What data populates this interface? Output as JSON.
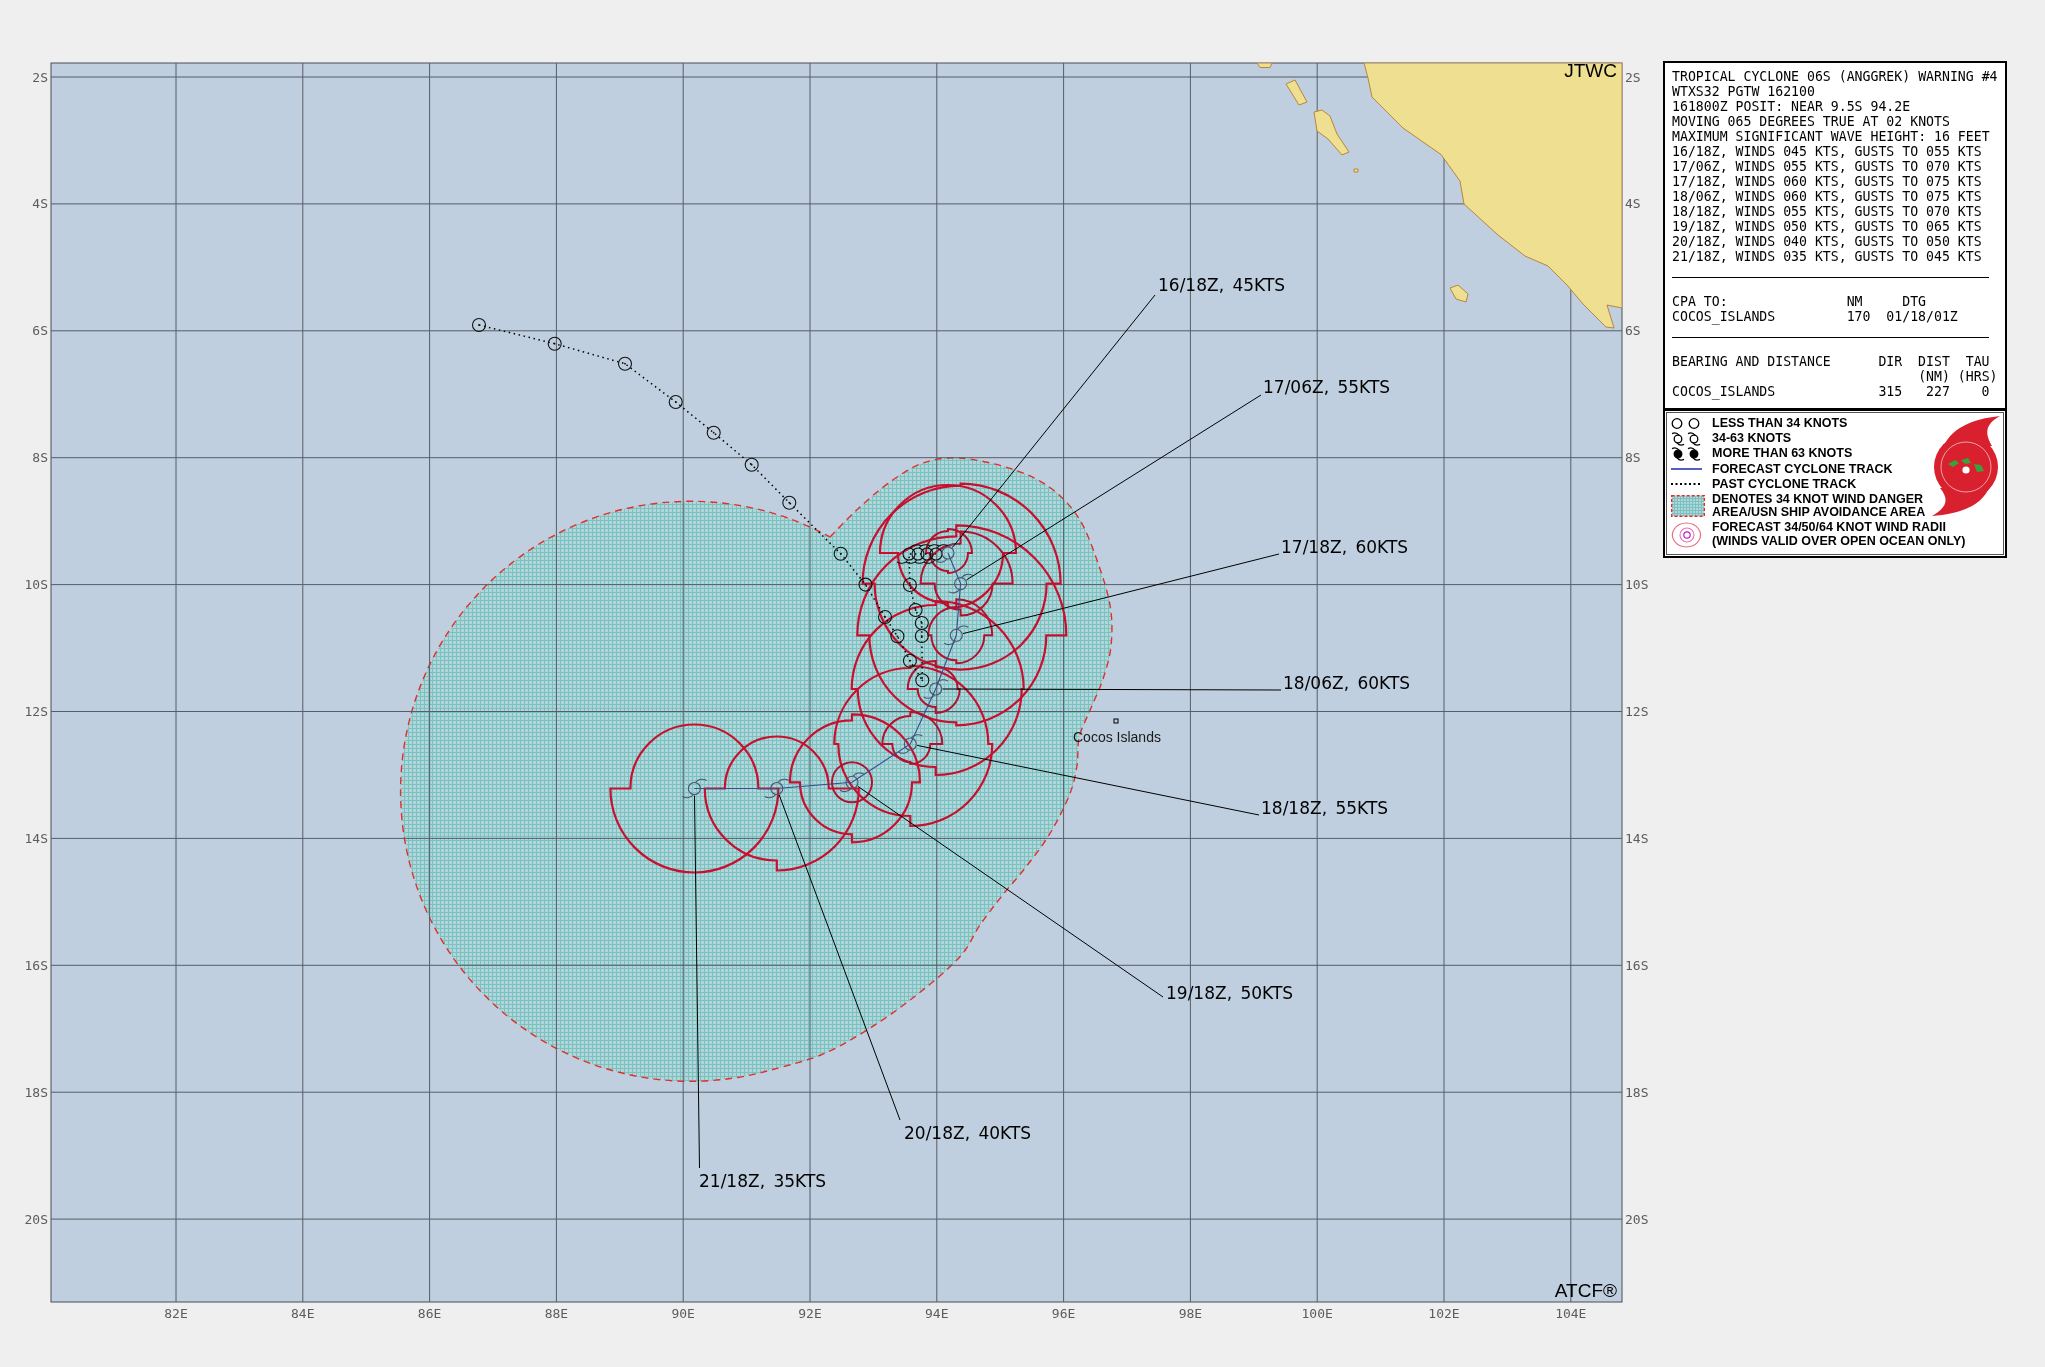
{
  "map": {
    "top_corner_label": "JTWC",
    "bottom_corner_label": "ATCF®",
    "latitude_labels_left": [
      "2S",
      "4S",
      "6S",
      "8S",
      "10S",
      "12S",
      "14S",
      "16S",
      "18S",
      "20S"
    ],
    "latitude_labels_right": [
      "2S",
      "4S",
      "6S",
      "8S",
      "10S",
      "12S",
      "14S",
      "16S",
      "18S",
      "20S"
    ],
    "longitude_labels": [
      "82E",
      "84E",
      "86E",
      "88E",
      "90E",
      "92E",
      "94E",
      "96E",
      "98E",
      "100E",
      "102E",
      "104E"
    ],
    "place_labels": [
      "Cocos Islands"
    ],
    "forecast_labels": [
      "16/18Z, 45KTS",
      "17/06Z, 55KTS",
      "17/18Z, 60KTS",
      "18/06Z, 60KTS",
      "18/18Z, 55KTS",
      "19/18Z, 50KTS",
      "20/18Z, 40KTS",
      "21/18Z, 35KTS"
    ]
  },
  "warning": {
    "lines": [
      "TROPICAL CYCLONE 06S (ANGGREK) WARNING #4",
      "WTXS32 PGTW 162100",
      "161800Z POSIT: NEAR 9.5S 94.2E",
      "MOVING 065 DEGREES TRUE AT 02 KNOTS",
      "MAXIMUM SIGNIFICANT WAVE HEIGHT: 16 FEET",
      "16/18Z, WINDS 045 KTS, GUSTS TO 055 KTS",
      "17/06Z, WINDS 055 KTS, GUSTS TO 070 KTS",
      "17/18Z, WINDS 060 KTS, GUSTS TO 075 KTS",
      "18/06Z, WINDS 060 KTS, GUSTS TO 075 KTS",
      "18/18Z, WINDS 055 KTS, GUSTS TO 070 KTS",
      "19/18Z, WINDS 050 KTS, GUSTS TO 065 KTS",
      "20/18Z, WINDS 040 KTS, GUSTS TO 050 KTS",
      "21/18Z, WINDS 035 KTS, GUSTS TO 045 KTS"
    ],
    "cpa": {
      "header": [
        "CPA TO:",
        "NM",
        "DTG"
      ],
      "rows": [
        [
          "COCOS_ISLANDS",
          "170",
          "01/18/01Z"
        ]
      ]
    },
    "bearing": {
      "header": [
        "BEARING AND DISTANCE",
        "DIR",
        "DIST",
        "TAU"
      ],
      "units": [
        "(NM)",
        "(HRS)"
      ],
      "rows": [
        [
          "COCOS_ISLANDS",
          "315",
          "227",
          "0"
        ]
      ]
    }
  },
  "legend": {
    "items": [
      {
        "kind": "open-symbol",
        "lines": [
          "LESS THAN 34 KNOTS"
        ]
      },
      {
        "kind": "storm-symbol",
        "lines": [
          "34-63 KNOTS"
        ]
      },
      {
        "kind": "intense-symbol",
        "lines": [
          "MORE THAN 63 KNOTS"
        ]
      },
      {
        "kind": "forecast-track",
        "lines": [
          "FORECAST CYCLONE TRACK"
        ]
      },
      {
        "kind": "past-track",
        "lines": [
          "PAST CYCLONE TRACK"
        ]
      },
      {
        "kind": "danger-area",
        "lines": [
          "DENOTES 34 KNOT WIND DANGER",
          "AREA/USN SHIP AVOIDANCE AREA"
        ]
      },
      {
        "kind": "wind-radii",
        "lines": [
          "FORECAST 34/50/64 KNOT WIND RADII",
          "(WINDS VALID OVER OPEN OCEAN ONLY)"
        ]
      }
    ]
  }
}
